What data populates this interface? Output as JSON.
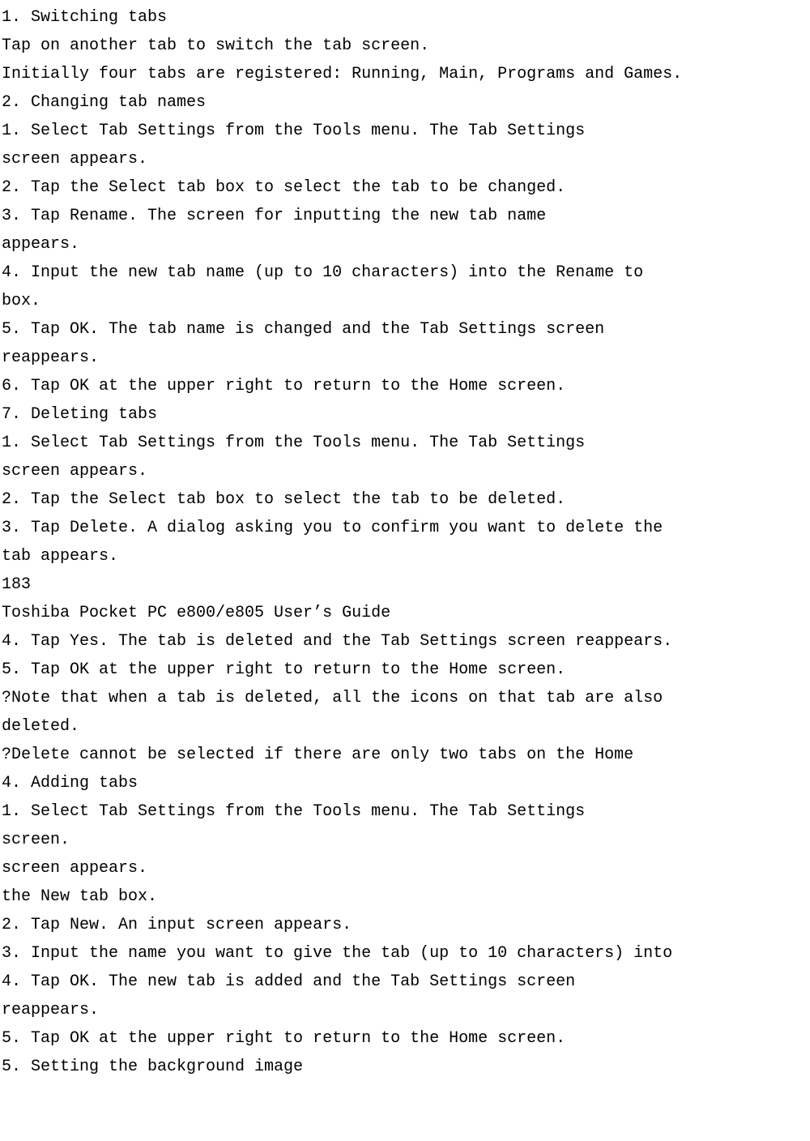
{
  "lines": [
    "1. Switching tabs",
    "Tap on another tab to switch the tab screen.",
    "Initially four tabs are registered: Running, Main, Programs and Games.",
    "2. Changing tab names",
    "1. Select Tab Settings from the Tools menu. The Tab Settings",
    "screen appears.",
    "2. Tap the Select tab box to select the tab to be changed.",
    "3. Tap Rename. The screen for inputting the new tab name",
    "appears.",
    "4. Input the new tab name (up to 10 characters) into the Rename to",
    "box.",
    "5. Tap OK. The tab name is changed and the Tab Settings screen",
    "reappears.",
    "6. Tap OK at the upper right to return to the Home screen.",
    "7. Deleting tabs",
    "1. Select Tab Settings from the Tools menu. The Tab Settings",
    "screen appears.",
    "2. Tap the Select tab box to select the tab to be deleted.",
    "3. Tap Delete. A dialog asking you to confirm you want to delete the",
    "tab appears.",
    "183",
    "Toshiba Pocket PC e800/e805 User’s Guide",
    "4. Tap Yes. The tab is deleted and the Tab Settings screen reappears.",
    "5. Tap OK at the upper right to return to the Home screen.",
    "?Note that when a tab is deleted, all the icons on that tab are also",
    "deleted.",
    "?Delete cannot be selected if there are only two tabs on the Home",
    "4. Adding tabs",
    "1. Select Tab Settings from the Tools menu. The Tab Settings",
    "screen.",
    "screen appears.",
    "the New tab box.",
    "2. Tap New. An input screen appears.",
    "3. Input the name you want to give the tab (up to 10 characters) into",
    "4. Tap OK. The new tab is added and the Tab Settings screen",
    "reappears.",
    "5. Tap OK at the upper right to return to the Home screen.",
    "5. Setting the background image"
  ]
}
